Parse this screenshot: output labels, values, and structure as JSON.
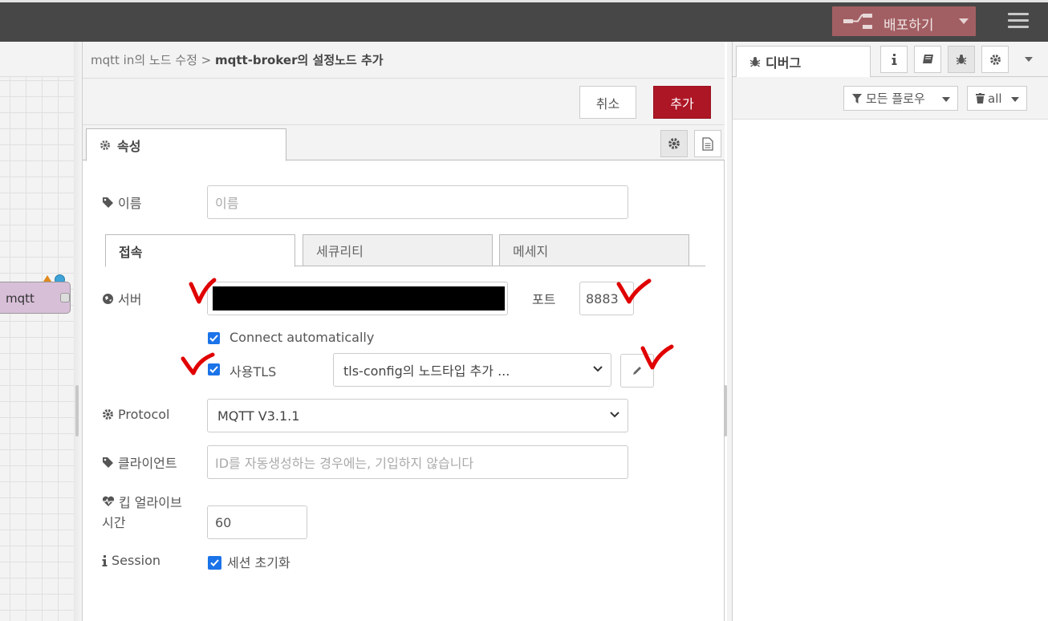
{
  "header": {
    "deploy_label": "배포하기"
  },
  "workspace": {
    "node_label": "mqtt"
  },
  "tray": {
    "breadcrumb_parent": "mqtt in의 노드 수정 > ",
    "breadcrumb_current": "mqtt-broker의 설정노드 추가",
    "cancel_label": "취소",
    "add_label": "추가",
    "tab_properties": "속성"
  },
  "form": {
    "name_label": "이름",
    "name_placeholder": "이름",
    "subtabs": [
      "접속",
      "세큐리티",
      "메세지"
    ],
    "server_label": "서버",
    "port_label": "포트",
    "port_value": "8883",
    "connect_auto_label": "Connect automatically",
    "use_tls_label": "사용TLS",
    "tls_select_value": "tls-config의 노드타입 추가 ...",
    "protocol_label": "Protocol",
    "protocol_value": "MQTT V3.1.1",
    "client_label": "클라이언트",
    "client_placeholder": "ID를 자동생성하는 경우에는, 기입하지 않습니다",
    "keepalive_label_line1": "킵 얼라이브",
    "keepalive_label_line2": "시간",
    "keepalive_value": "60",
    "session_label": "Session",
    "session_checkbox_label": "세션 초기화"
  },
  "sidebar": {
    "debug_tab_label": "디버그",
    "filter_label": "모든 플로우",
    "clear_label": "all"
  },
  "colors": {
    "header_bg": "#474747",
    "deploy_bg": "#a25f63",
    "primary_button": "#ad1625",
    "checkbox": "#1a73e8",
    "annotation_marks": "#e00000"
  }
}
